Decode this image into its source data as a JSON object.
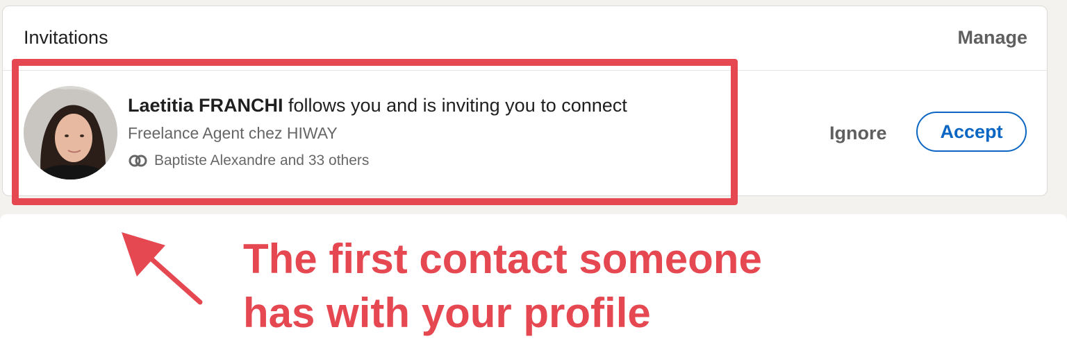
{
  "invitations": {
    "title": "Invitations",
    "manage_label": "Manage",
    "item": {
      "name": "Laetitia FRANCHI",
      "action_text": " follows you and is inviting you to connect",
      "headline": "Freelance Agent chez HIWAY",
      "mutual": "Baptiste Alexandre and 33 others",
      "ignore_label": "Ignore",
      "accept_label": "Accept",
      "avatar_icon": "profile-photo",
      "mutual_icon": "mutual-connections-icon"
    }
  },
  "annotation": {
    "line1": "The first contact someone",
    "line2": "has with your profile",
    "color": "#e64852"
  },
  "colors": {
    "accent": "#0a66c2",
    "page_bg": "#f4f2ee"
  }
}
